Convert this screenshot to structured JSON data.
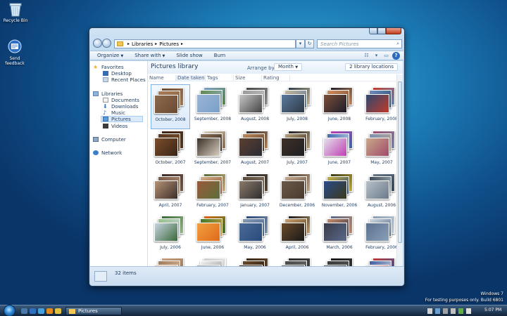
{
  "desktop": {
    "icons": [
      {
        "label": "Recycle Bin"
      },
      {
        "label": "Send feedback"
      }
    ],
    "watermark": {
      "line1": "Windows 7",
      "line2": "For testing purposes only. Build 6801"
    }
  },
  "window": {
    "address": {
      "crumbs": [
        "Libraries",
        "Pictures"
      ]
    },
    "search_placeholder": "Search Pictures",
    "toolbar": {
      "organize": "Organize",
      "share_with": "Share with",
      "slide_show": "Slide show",
      "burn": "Burn"
    },
    "nav": {
      "favorites": "Favorites",
      "desktop": "Desktop",
      "recent": "Recent Places",
      "libraries": "Libraries",
      "documents": "Documents",
      "downloads": "Downloads",
      "music": "Music",
      "pictures": "Pictures",
      "videos": "Videos",
      "computer": "Computer",
      "network": "Network"
    },
    "library": {
      "title": "Pictures library",
      "arrange_label": "Arrange by:",
      "arrange_value": "Month",
      "locations": "2 library locations"
    },
    "columns": [
      "Name",
      "Date taken",
      "Tags",
      "Size",
      "Rating"
    ],
    "groups": [
      {
        "label": "October, 2008",
        "colors": [
          "#6b4a34",
          "#a97b56",
          "#8b6a4b"
        ]
      },
      {
        "label": "September, 2008",
        "colors": [
          "#7aa0c9",
          "#5e8b4d",
          "#9ab4d4"
        ]
      },
      {
        "label": "August, 2008",
        "colors": [
          "#444444",
          "#9a9a9a",
          "#c7c7c7"
        ]
      },
      {
        "label": "July, 2008",
        "colors": [
          "#2f3a46",
          "#c9b89a",
          "#5a7a9e"
        ]
      },
      {
        "label": "June, 2008",
        "colors": [
          "#1d1d2a",
          "#d28c5a",
          "#7b4f3a"
        ]
      },
      {
        "label": "February, 2008",
        "colors": [
          "#c0392b",
          "#6c8ebf",
          "#2c4a6f"
        ]
      },
      {
        "label": "October, 2007",
        "colors": [
          "#3b2416",
          "#5a3a22",
          "#7b4e2c"
        ]
      },
      {
        "label": "September, 2007",
        "colors": [
          "#d9d0c1",
          "#8d6e52",
          "#3a3027"
        ]
      },
      {
        "label": "August, 2007",
        "colors": [
          "#2a2a33",
          "#c08a5a",
          "#5c4030"
        ]
      },
      {
        "label": "July, 2007",
        "colors": [
          "#1e1e22",
          "#b9a179",
          "#3e3128"
        ]
      },
      {
        "label": "June, 2007",
        "colors": [
          "#c03fb4",
          "#3a68b0",
          "#e3e3ea"
        ]
      },
      {
        "label": "May, 2007",
        "colors": [
          "#a04a6a",
          "#7a8fb4",
          "#c9a98a"
        ]
      },
      {
        "label": "April, 2007",
        "colors": [
          "#3c2e2a",
          "#7a5a48",
          "#b59274"
        ]
      },
      {
        "label": "February, 2007",
        "colors": [
          "#5a6e3a",
          "#d3b08a",
          "#9a5a3a"
        ]
      },
      {
        "label": "January, 2007",
        "colors": [
          "#2e2e2e",
          "#5a4a3a",
          "#8a7a6a"
        ]
      },
      {
        "label": "December, 2006",
        "colors": [
          "#4a3a2e",
          "#c7a98b",
          "#6a5a4a"
        ]
      },
      {
        "label": "November, 2006",
        "colors": [
          "#3a3a1a",
          "#c8b23a",
          "#2a4a8a"
        ]
      },
      {
        "label": "August, 2006",
        "colors": [
          "#6a7a8a",
          "#3a4a5a",
          "#b8c0c8"
        ]
      },
      {
        "label": "July, 2006",
        "colors": [
          "#3a6a3a",
          "#9ac08a",
          "#c8d4e0"
        ]
      },
      {
        "label": "June, 2006",
        "colors": [
          "#e06a1a",
          "#3a7a2a",
          "#f0a040"
        ]
      },
      {
        "label": "May, 2006",
        "colors": [
          "#2a4a7a",
          "#8a9ab0",
          "#4a6a9a"
        ]
      },
      {
        "label": "April, 2006",
        "colors": [
          "#1a1a1a",
          "#c8a070",
          "#6a4a2a"
        ]
      },
      {
        "label": "March, 2006",
        "colors": [
          "#5a6a8a",
          "#c88a6a",
          "#3a3a4a"
        ]
      },
      {
        "label": "February, 2006",
        "colors": [
          "#8aa0b8",
          "#d0d8e0",
          "#5a7090"
        ]
      },
      {
        "label": "",
        "colors": [
          "#c8a080",
          "#a07a5a",
          "#e0c0a0"
        ]
      },
      {
        "label": "",
        "colors": [
          "#d0d0d0",
          "#f0f0f0",
          "#a0a0a0"
        ]
      },
      {
        "label": "",
        "colors": [
          "#3a2a1a",
          "#6a4a2a",
          "#2a1a10"
        ]
      },
      {
        "label": "",
        "colors": [
          "#2a2a2a",
          "#4a4a4a",
          "#6a6a6a"
        ]
      },
      {
        "label": "",
        "colors": [
          "#1a1a1a",
          "#3a3a3a",
          "#5a5a5a"
        ]
      },
      {
        "label": "",
        "colors": [
          "#c03a3a",
          "#3a5aa0",
          "#e0e0e0"
        ]
      },
      {
        "label": "",
        "colors": [
          "#7a8a9a",
          "#a0b0c0",
          "#4a5a6a"
        ]
      }
    ],
    "selected_index": 0,
    "status": "32 items"
  },
  "taskbar": {
    "window_button": "Pictures",
    "clock": "5:07 PM"
  }
}
